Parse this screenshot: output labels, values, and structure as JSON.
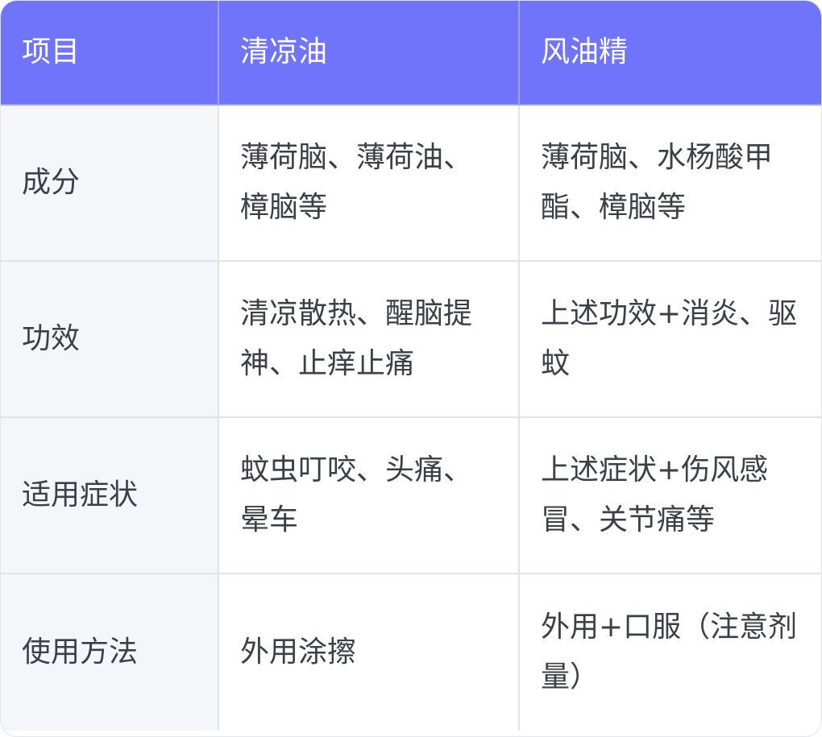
{
  "table": {
    "headers": [
      "项目",
      "清凉油",
      "风油精"
    ],
    "rows": [
      {
        "item": "成分",
        "cooling_oil": "薄荷脑、薄荷油、樟脑等",
        "wind_oil": "薄荷脑、水杨酸甲酯、樟脑等"
      },
      {
        "item": "功效",
        "cooling_oil": "清凉散热、醒脑提神、止痒止痛",
        "wind_oil": "上述功效+消炎、驱蚊"
      },
      {
        "item": "适用症状",
        "cooling_oil": "蚊虫叮咬、头痛、晕车",
        "wind_oil": "上述症状+伤风感冒、关节痛等"
      },
      {
        "item": "使用方法",
        "cooling_oil": "外用涂擦",
        "wind_oil": "外用+口服（注意剂量）"
      }
    ]
  },
  "colors": {
    "header_bg": "#6f74fb",
    "header_text": "#ffffff",
    "item_col_bg": "#f5f6fa",
    "body_text": "#3b3f47",
    "grid_line": "#e1e3e8"
  }
}
